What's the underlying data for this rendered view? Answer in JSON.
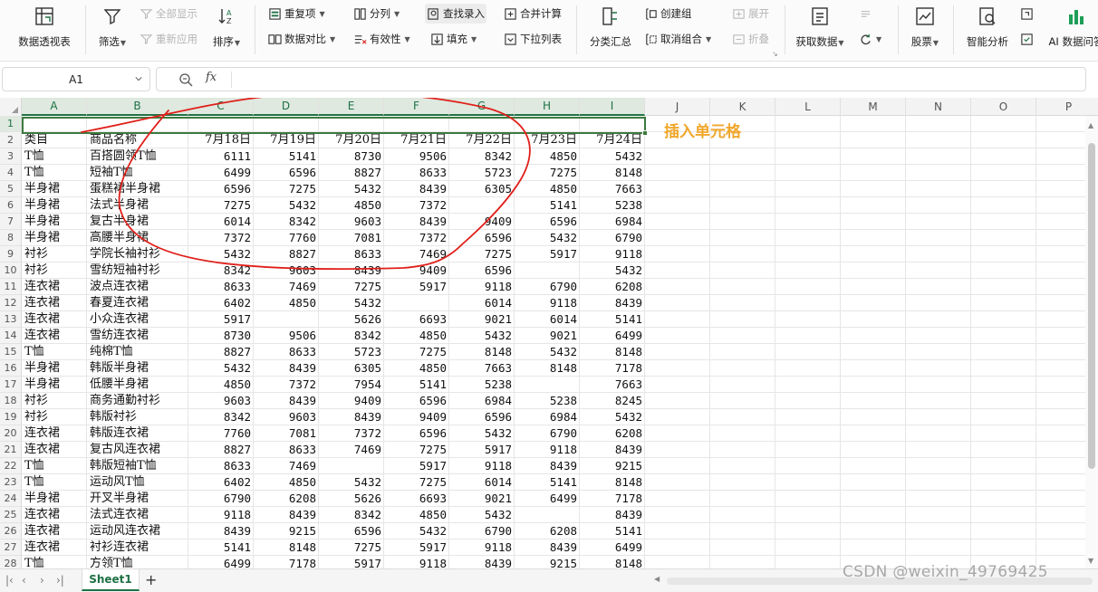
{
  "ribbon": {
    "pivot_label": "数据透视表",
    "filter_label": "筛选",
    "show_all_label": "全部显示",
    "reapply_label": "重新应用",
    "sort_label": "排序",
    "duplicates_label": "重复项",
    "compare_label": "数据对比",
    "split_label": "分列",
    "validity_label": "有效性",
    "find_entry_label": "查找录入",
    "fill_label": "填充",
    "merge_calc_label": "合并计算",
    "dropdown_list_label": "下拉列表",
    "subtotal_label": "分类汇总",
    "create_group_label": "创建组",
    "ungroup_label": "取消组合",
    "expand_label": "展开",
    "collapse_label": "折叠",
    "get_data_label": "获取数据",
    "stocks_label": "股票",
    "smart_analysis_label": "智能分析",
    "ai_qa_label": "AI 数据问答"
  },
  "formula_bar": {
    "cell_ref": "A1",
    "fx": "fx",
    "formula": ""
  },
  "columns": [
    "A",
    "B",
    "C",
    "D",
    "E",
    "F",
    "G",
    "H",
    "I",
    "J",
    "K",
    "L",
    "M",
    "N",
    "O",
    "P"
  ],
  "rows": [
    {
      "n": "1",
      "c": [
        "",
        "",
        "",
        "",
        "",
        "",
        "",
        ""
      ]
    },
    {
      "n": "2",
      "c": [
        "类目",
        "商品名称",
        "7月18日",
        "7月19日",
        "7月20日",
        "7月21日",
        "7月22日",
        "7月23日",
        "7月24日"
      ]
    },
    {
      "n": "3",
      "c": [
        "T恤",
        "百搭圆领T恤",
        "6111",
        "5141",
        "8730",
        "9506",
        "8342",
        "4850",
        "5432"
      ]
    },
    {
      "n": "4",
      "c": [
        "T恤",
        "短袖T恤",
        "6499",
        "6596",
        "8827",
        "8633",
        "5723",
        "7275",
        "8148"
      ]
    },
    {
      "n": "5",
      "c": [
        "半身裙",
        "蛋糕裙半身裙",
        "6596",
        "7275",
        "5432",
        "8439",
        "6305",
        "4850",
        "7663"
      ]
    },
    {
      "n": "6",
      "c": [
        "半身裙",
        "法式半身裙",
        "7275",
        "5432",
        "4850",
        "7372",
        "",
        "5141",
        "5238"
      ]
    },
    {
      "n": "7",
      "c": [
        "半身裙",
        "复古半身裙",
        "6014",
        "8342",
        "9603",
        "8439",
        "9409",
        "6596",
        "6984"
      ]
    },
    {
      "n": "8",
      "c": [
        "半身裙",
        "高腰半身裙",
        "7372",
        "7760",
        "7081",
        "7372",
        "6596",
        "5432",
        "6790"
      ]
    },
    {
      "n": "9",
      "c": [
        "衬衫",
        "学院长袖衬衫",
        "5432",
        "8827",
        "8633",
        "7469",
        "7275",
        "5917",
        "9118"
      ]
    },
    {
      "n": "10",
      "c": [
        "衬衫",
        "雪纺短袖衬衫",
        "8342",
        "9603",
        "8439",
        "9409",
        "6596",
        "",
        "5432"
      ]
    },
    {
      "n": "11",
      "c": [
        "连衣裙",
        "波点连衣裙",
        "8633",
        "7469",
        "7275",
        "5917",
        "9118",
        "6790",
        "6208"
      ]
    },
    {
      "n": "12",
      "c": [
        "连衣裙",
        "春夏连衣裙",
        "6402",
        "4850",
        "5432",
        "",
        "6014",
        "9118",
        "8439"
      ]
    },
    {
      "n": "13",
      "c": [
        "连衣裙",
        "小众连衣裙",
        "5917",
        "",
        "5626",
        "6693",
        "9021",
        "6014",
        "5141"
      ]
    },
    {
      "n": "14",
      "c": [
        "连衣裙",
        "雪纺连衣裙",
        "8730",
        "9506",
        "8342",
        "4850",
        "5432",
        "9021",
        "6499"
      ]
    },
    {
      "n": "15",
      "c": [
        "T恤",
        "纯棉T恤",
        "8827",
        "8633",
        "5723",
        "7275",
        "8148",
        "5432",
        "8148"
      ]
    },
    {
      "n": "16",
      "c": [
        "半身裙",
        "韩版半身裙",
        "5432",
        "8439",
        "6305",
        "4850",
        "7663",
        "8148",
        "7178"
      ]
    },
    {
      "n": "17",
      "c": [
        "半身裙",
        "低腰半身裙",
        "4850",
        "7372",
        "7954",
        "5141",
        "5238",
        "",
        "7663"
      ]
    },
    {
      "n": "18",
      "c": [
        "衬衫",
        "商务通勤衬衫",
        "9603",
        "8439",
        "9409",
        "6596",
        "6984",
        "5238",
        "8245"
      ]
    },
    {
      "n": "19",
      "c": [
        "衬衫",
        "韩版衬衫",
        "8342",
        "9603",
        "8439",
        "9409",
        "6596",
        "6984",
        "5432"
      ]
    },
    {
      "n": "20",
      "c": [
        "连衣裙",
        "韩版连衣裙",
        "7760",
        "7081",
        "7372",
        "6596",
        "5432",
        "6790",
        "6208"
      ]
    },
    {
      "n": "21",
      "c": [
        "连衣裙",
        "复古风连衣裙",
        "8827",
        "8633",
        "7469",
        "7275",
        "5917",
        "9118",
        "8439"
      ]
    },
    {
      "n": "22",
      "c": [
        "T恤",
        "韩版短袖T恤",
        "8633",
        "7469",
        "",
        "5917",
        "9118",
        "8439",
        "9215"
      ]
    },
    {
      "n": "23",
      "c": [
        "T恤",
        "运动风T恤",
        "6402",
        "4850",
        "5432",
        "7275",
        "6014",
        "5141",
        "8148"
      ]
    },
    {
      "n": "24",
      "c": [
        "半身裙",
        "开叉半身裙",
        "6790",
        "6208",
        "5626",
        "6693",
        "9021",
        "6499",
        "7178"
      ]
    },
    {
      "n": "25",
      "c": [
        "连衣裙",
        "法式连衣裙",
        "9118",
        "8439",
        "8342",
        "4850",
        "5432",
        "",
        "8439"
      ]
    },
    {
      "n": "26",
      "c": [
        "连衣裙",
        "运动风连衣裙",
        "8439",
        "9215",
        "6596",
        "5432",
        "6790",
        "6208",
        "5141"
      ]
    },
    {
      "n": "27",
      "c": [
        "连衣裙",
        "衬衫连衣裙",
        "5141",
        "8148",
        "7275",
        "5917",
        "9118",
        "8439",
        "6499"
      ]
    },
    {
      "n": "28",
      "c": [
        "T恤",
        "方领T恤",
        "6499",
        "7178",
        "5917",
        "9118",
        "8439",
        "9215",
        "8148"
      ]
    }
  ],
  "annotation": {
    "label": "插入单元格",
    "color": "#f0a72a",
    "circle_color": "#e0201a"
  },
  "tabs": {
    "sheet_name": "Sheet1",
    "add": "+"
  },
  "watermark": "CSDN @weixin_49769425",
  "colors": {
    "accent": "#217346",
    "selection": "#3d7a3f"
  }
}
